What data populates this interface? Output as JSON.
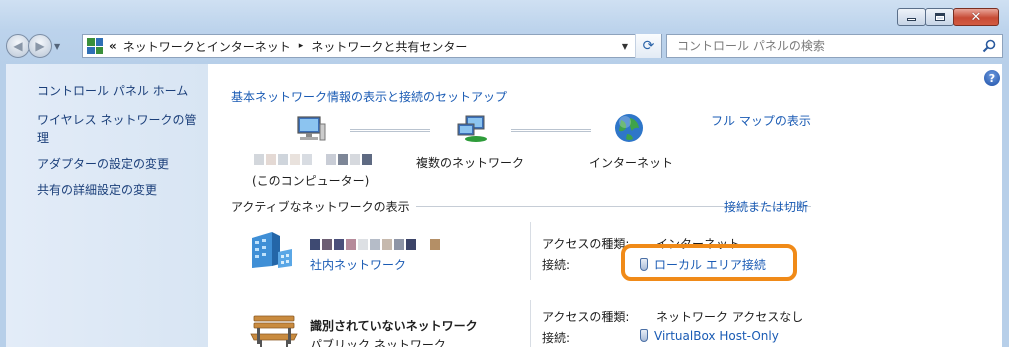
{
  "window": {
    "caption": {
      "minimize": "minimize",
      "maximize": "maximize",
      "close": "✕"
    }
  },
  "nav": {
    "breadcrumb_overflow": "«",
    "breadcrumb": [
      "ネットワークとインターネット",
      "ネットワークと共有センター"
    ],
    "breadcrumb_sep": "▸",
    "refresh_glyph": "⟳",
    "search_placeholder": "コントロール パネルの検索"
  },
  "sidebar": {
    "items": [
      {
        "label": "コントロール パネル ホーム"
      },
      {
        "label": "ワイヤレス ネットワークの管理"
      },
      {
        "label": "アダプターの設定の変更"
      },
      {
        "label": "共有の詳細設定の変更"
      }
    ]
  },
  "main": {
    "help_glyph": "?",
    "setup_title": "基本ネットワーク情報の表示と接続のセットアップ",
    "full_map": "フル マップの表示",
    "map": {
      "computer_name_caption": "(このコンピューター)",
      "multiple_networks": "複数のネットワーク",
      "internet": "インターネット"
    },
    "active_networks_title": "アクティブなネットワークの表示",
    "connect_disconnect": "接続または切断",
    "networks": [
      {
        "type_label": "社内ネットワーク",
        "access_type_label": "アクセスの種類:",
        "access_type_value": "インターネット",
        "connection_label": "接続:",
        "connection_value": "ローカル エリア接続"
      },
      {
        "name": "識別されていないネットワーク",
        "type_label": "パブリック ネットワーク",
        "access_type_label": "アクセスの種類:",
        "access_type_value": "ネットワーク アクセスなし",
        "connection_label": "接続:",
        "connection_value": "VirtualBox Host-Only"
      }
    ]
  },
  "colors": {
    "link": "#1a5bb4",
    "highlight": "#f08a18",
    "sidebar_link": "#1b3f7a"
  }
}
